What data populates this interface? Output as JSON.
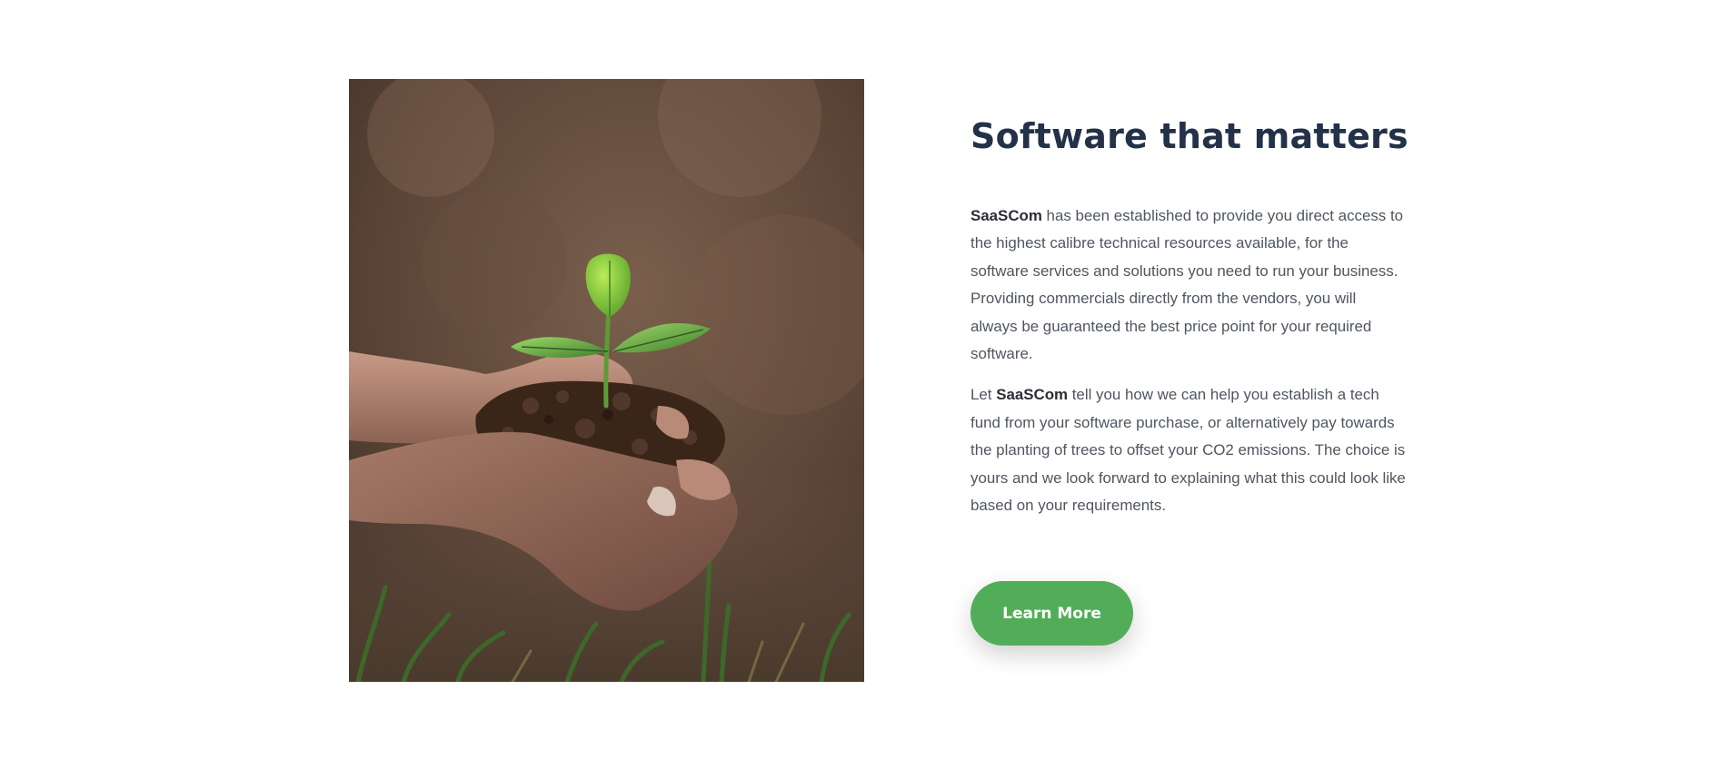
{
  "image": {
    "alt": "",
    "icon": "seedling-in-hands-photo"
  },
  "colors": {
    "heading": "#233149",
    "body_text": "#4f5660",
    "button_bg": "#52ad59",
    "button_text": "#ffffff",
    "background": "#ffffff"
  },
  "content": {
    "heading": "Software that matters",
    "paragraph1": {
      "brand": "SaaSCom",
      "text": " has been established to provide you direct access to the highest calibre technical resources available, for the software services and solutions you need to run your business. Providing commercials directly from the vendors, you will always be guaranteed the best price point for your required software."
    },
    "paragraph2": {
      "prefix": "Let ",
      "brand": "SaaSCom",
      "text": " tell you how we can help you establish a tech fund from your software purchase, or alternatively pay towards the planting of trees to offset your CO2 emissions.  The choice is yours and we look forward to explaining what this could look like based on your requirements."
    },
    "button_label": "Learn More"
  }
}
